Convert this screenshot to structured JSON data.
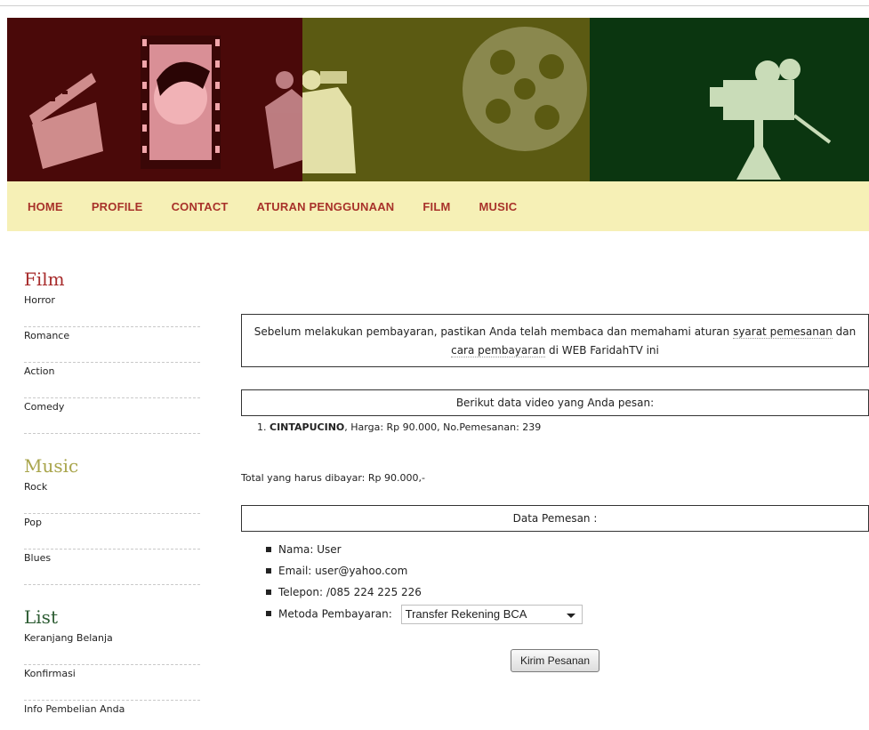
{
  "nav": {
    "items": [
      "HOME",
      "PROFILE",
      "CONTACT",
      "ATURAN PENGGUNAAN",
      "FILM",
      "MUSIC"
    ]
  },
  "sidebar": {
    "film": {
      "title": "Film",
      "items": [
        "Horror",
        "Romance",
        "Action",
        "Comedy"
      ]
    },
    "music": {
      "title": "Music",
      "items": [
        "Rock",
        "Pop",
        "Blues"
      ]
    },
    "list": {
      "title": "List",
      "items": [
        "Keranjang Belanja",
        "Konfirmasi",
        "Info Pembelian Anda"
      ]
    }
  },
  "notice": {
    "pre": "Sebelum melakukan pembayaran, pastikan Anda telah membaca dan memahami aturan ",
    "link1": "syarat pemesanan",
    "mid": " dan ",
    "link2": "cara pembayaran",
    "post": " di WEB FaridahTV ini"
  },
  "order_header": "Berikut data video yang Anda pesan:",
  "orders": [
    {
      "title": "CINTAPUCINO",
      "price_label": "Harga: Rp 90.000",
      "order_no_label": "No.Pemesanan: 239"
    }
  ],
  "total": "Total yang harus dibayar: Rp 90.000,-",
  "buyer_header": "Data Pemesan :",
  "buyer": {
    "name": "Nama: User",
    "email": "Email: user@yahoo.com",
    "phone": "Telepon: /085 224 225 226",
    "payment_label": "Metoda Pembayaran:",
    "payment_value": "Transfer Rekening BCA"
  },
  "submit_label": "Kirim Pesanan",
  "colors": {
    "banner_red": "#4a0909",
    "banner_olive": "#5b5a12",
    "banner_green": "#0b3610",
    "nav_bg": "#f6f0b6",
    "nav_text": "#a8322a"
  }
}
